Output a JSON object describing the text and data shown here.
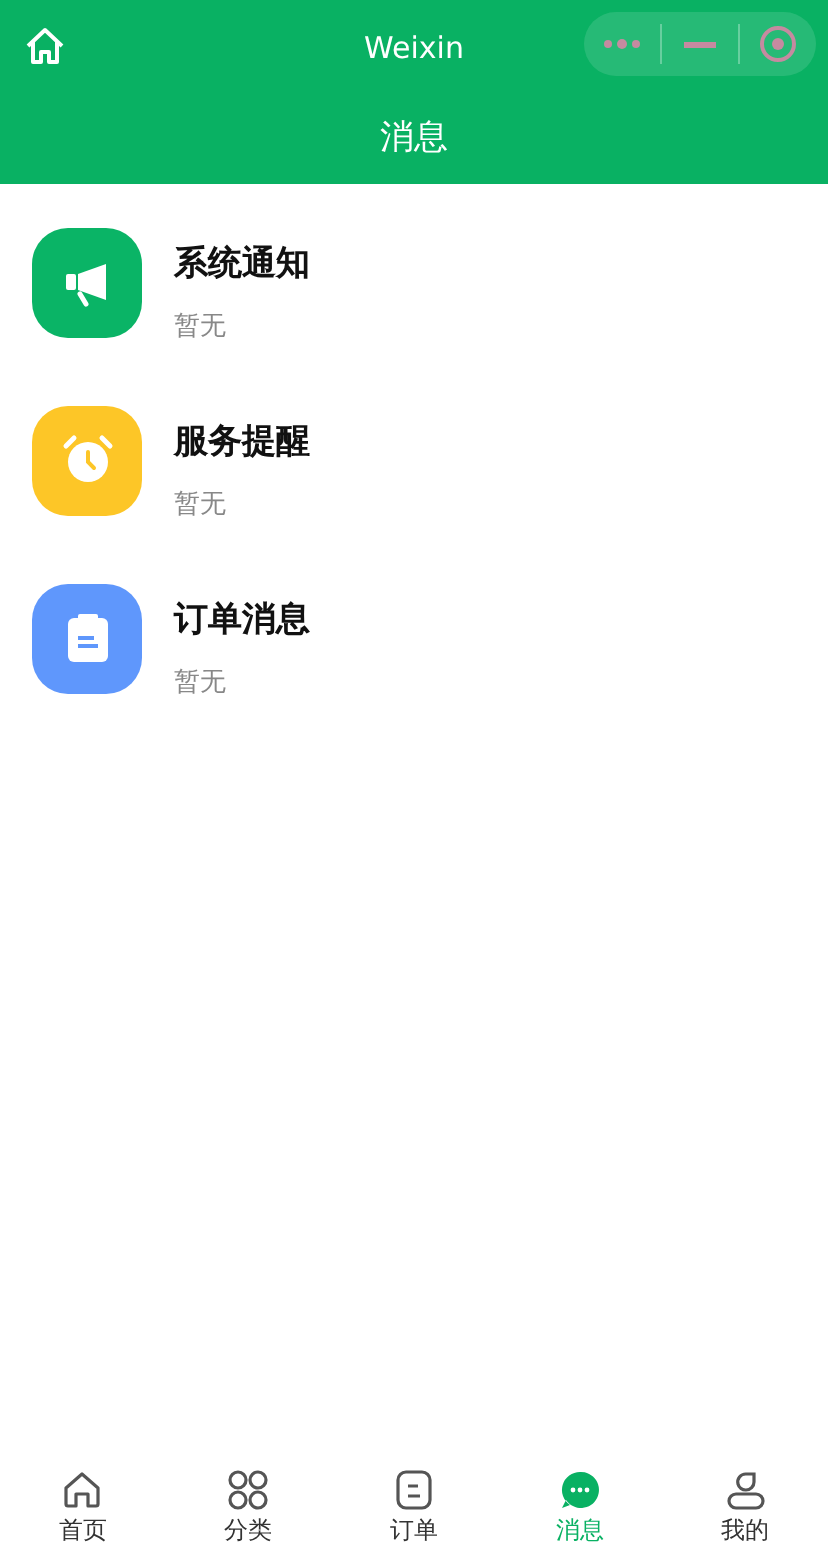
{
  "top_bar": {
    "title": "Weixin"
  },
  "header": {
    "title": "消息"
  },
  "messages": [
    {
      "kind": "megaphone",
      "color": "#0ab466",
      "title": "系统通知",
      "subtitle": "暂无"
    },
    {
      "kind": "alarm",
      "color": "#fdc627",
      "title": "服务提醒",
      "subtitle": "暂无"
    },
    {
      "kind": "clipboard",
      "color": "#5f97fc",
      "title": "订单消息",
      "subtitle": "暂无"
    }
  ],
  "tabs": [
    {
      "kind": "home",
      "label": "首页",
      "selected": false
    },
    {
      "kind": "category",
      "label": "分类",
      "selected": false
    },
    {
      "kind": "order",
      "label": "订单",
      "selected": false
    },
    {
      "kind": "message",
      "label": "消息",
      "selected": true
    },
    {
      "kind": "profile",
      "label": "我的",
      "selected": false
    }
  ]
}
